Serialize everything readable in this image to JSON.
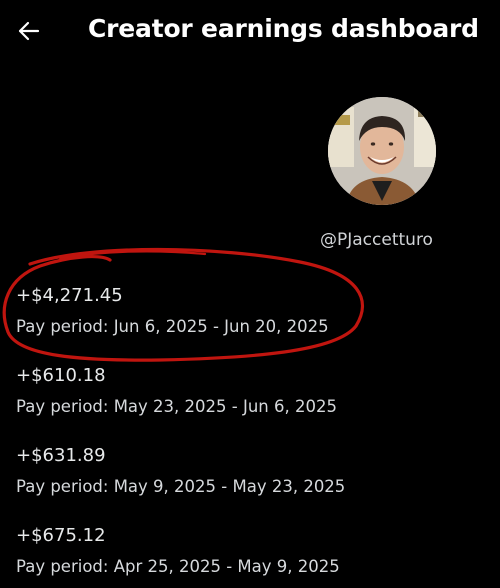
{
  "header": {
    "title": "Creator earnings dashboard",
    "back_icon": "arrow-left-icon"
  },
  "profile": {
    "handle": "@PJaccetturo",
    "avatar": "profile-photo"
  },
  "payouts": [
    {
      "amount": "+$4,271.45",
      "period": "Pay period: Jun 6, 2025 - Jun 20, 2025",
      "highlighted": true
    },
    {
      "amount": "+$610.18",
      "period": "Pay period: May 23, 2025 - Jun 6, 2025",
      "highlighted": false
    },
    {
      "amount": "+$631.89",
      "period": "Pay period: May 9, 2025 - May 23, 2025",
      "highlighted": false
    },
    {
      "amount": "+$675.12",
      "period": "Pay period: Apr 25, 2025 - May 9, 2025",
      "highlighted": false
    }
  ],
  "colors": {
    "background": "#000000",
    "text_primary": "#e7e9ea",
    "highlight_annotation": "#c0150f"
  }
}
